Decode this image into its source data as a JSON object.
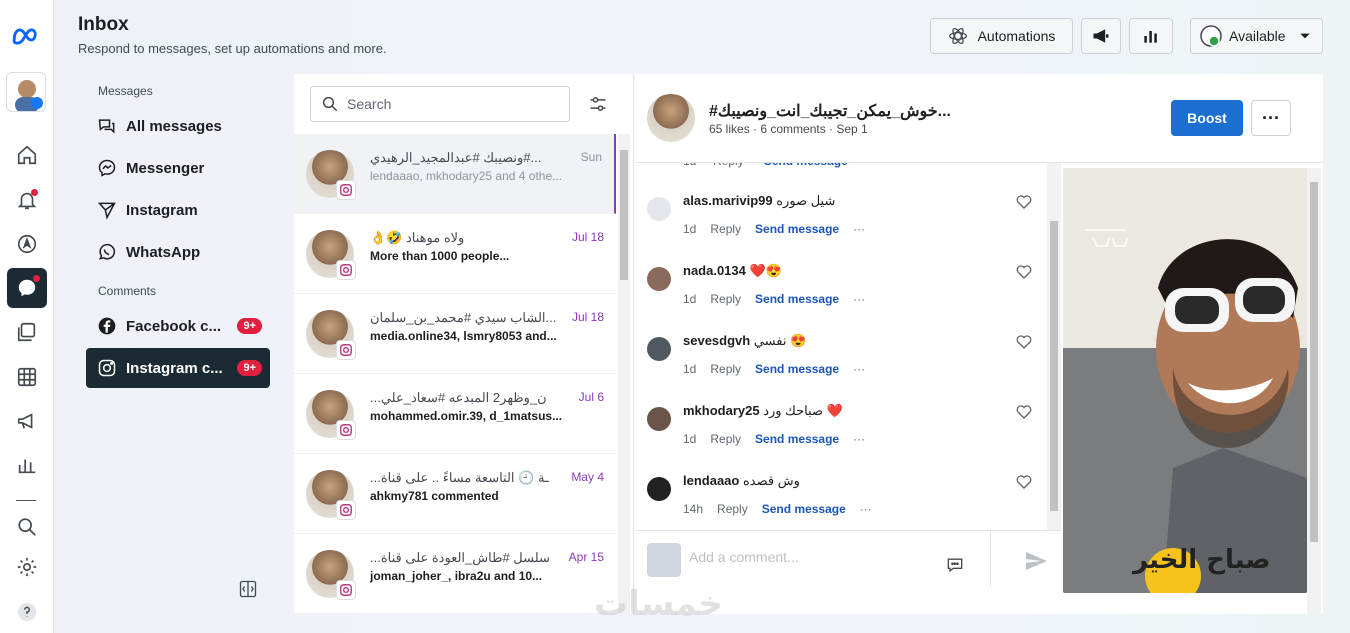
{
  "header": {
    "title": "Inbox",
    "subtitle": "Respond to messages, set up automations and more.",
    "automations_label": "Automations",
    "status_label": "Available"
  },
  "nav": {
    "messages_section": "Messages",
    "items": [
      {
        "label": "All messages"
      },
      {
        "label": "Messenger"
      },
      {
        "label": "Instagram"
      },
      {
        "label": "WhatsApp"
      }
    ],
    "comments_section": "Comments",
    "comment_items": [
      {
        "label": "Facebook c...",
        "badge": "9+"
      },
      {
        "label": "Instagram c...",
        "badge": "9+"
      }
    ]
  },
  "search": {
    "placeholder": "Search"
  },
  "conversations": [
    {
      "title": "ونصيبك #عبدالمجيد_الرهيدي#...",
      "preview": "lendaaao, mkhodary25 and 4 othe...",
      "date": "Sun"
    },
    {
      "title": "👌🤣 ولاه موهناد",
      "preview": "More than 1000 people...",
      "date": "Jul 18"
    },
    {
      "title": "الشاب سيدي #محمد_بن_سلمان...",
      "preview": "media.online34, lsmry8053 and...",
      "date": "Jul 18"
    },
    {
      "title": "...ن_وظهر2 المبدعه #سعاد_علي",
      "preview": "mohammed.omir.39, d_1matsus...",
      "date": "Jul 6"
    },
    {
      "title": "...ـة 🕘 التاسعة مساءً .. على قناة",
      "preview": "ahkmy781 commented",
      "date": "May 4"
    },
    {
      "title": "...سلسل #طاش_العودة على قناة",
      "preview": "joman_joher_, ibra2u and 10...",
      "date": "Apr 15"
    }
  ],
  "post": {
    "title": "#خوش_يمكن_تجيبك_انت_ونصيبك...",
    "meta": "65 likes · 6 comments · Sep 1",
    "boost_label": "Boost",
    "more_label": "···"
  },
  "comment_labels": {
    "reply": "Reply",
    "send": "Send message",
    "more": "···"
  },
  "comments": [
    {
      "user": "alas.marivip99",
      "text": "شيل صوره",
      "time": "1d"
    },
    {
      "user": "nada.0134",
      "text": "❤️😍",
      "time": "1d"
    },
    {
      "user": "sevesdgvh",
      "text": "نفسي 😍",
      "time": "1d"
    },
    {
      "user": "mkhodary25",
      "text": "صباحك ورد ❤️",
      "time": "1d"
    },
    {
      "user": "lendaaao",
      "text": "وش قصده",
      "time": "14h"
    }
  ],
  "composer": {
    "placeholder": "Add a comment..."
  },
  "media": {
    "sticker_text": "صباح الخير"
  },
  "watermark": "خمسات",
  "colors": {
    "accent": "#1a6fd0",
    "instagram": "#8a3ab9",
    "badge": "#e41e3f",
    "dark_active": "#1c2b33"
  }
}
